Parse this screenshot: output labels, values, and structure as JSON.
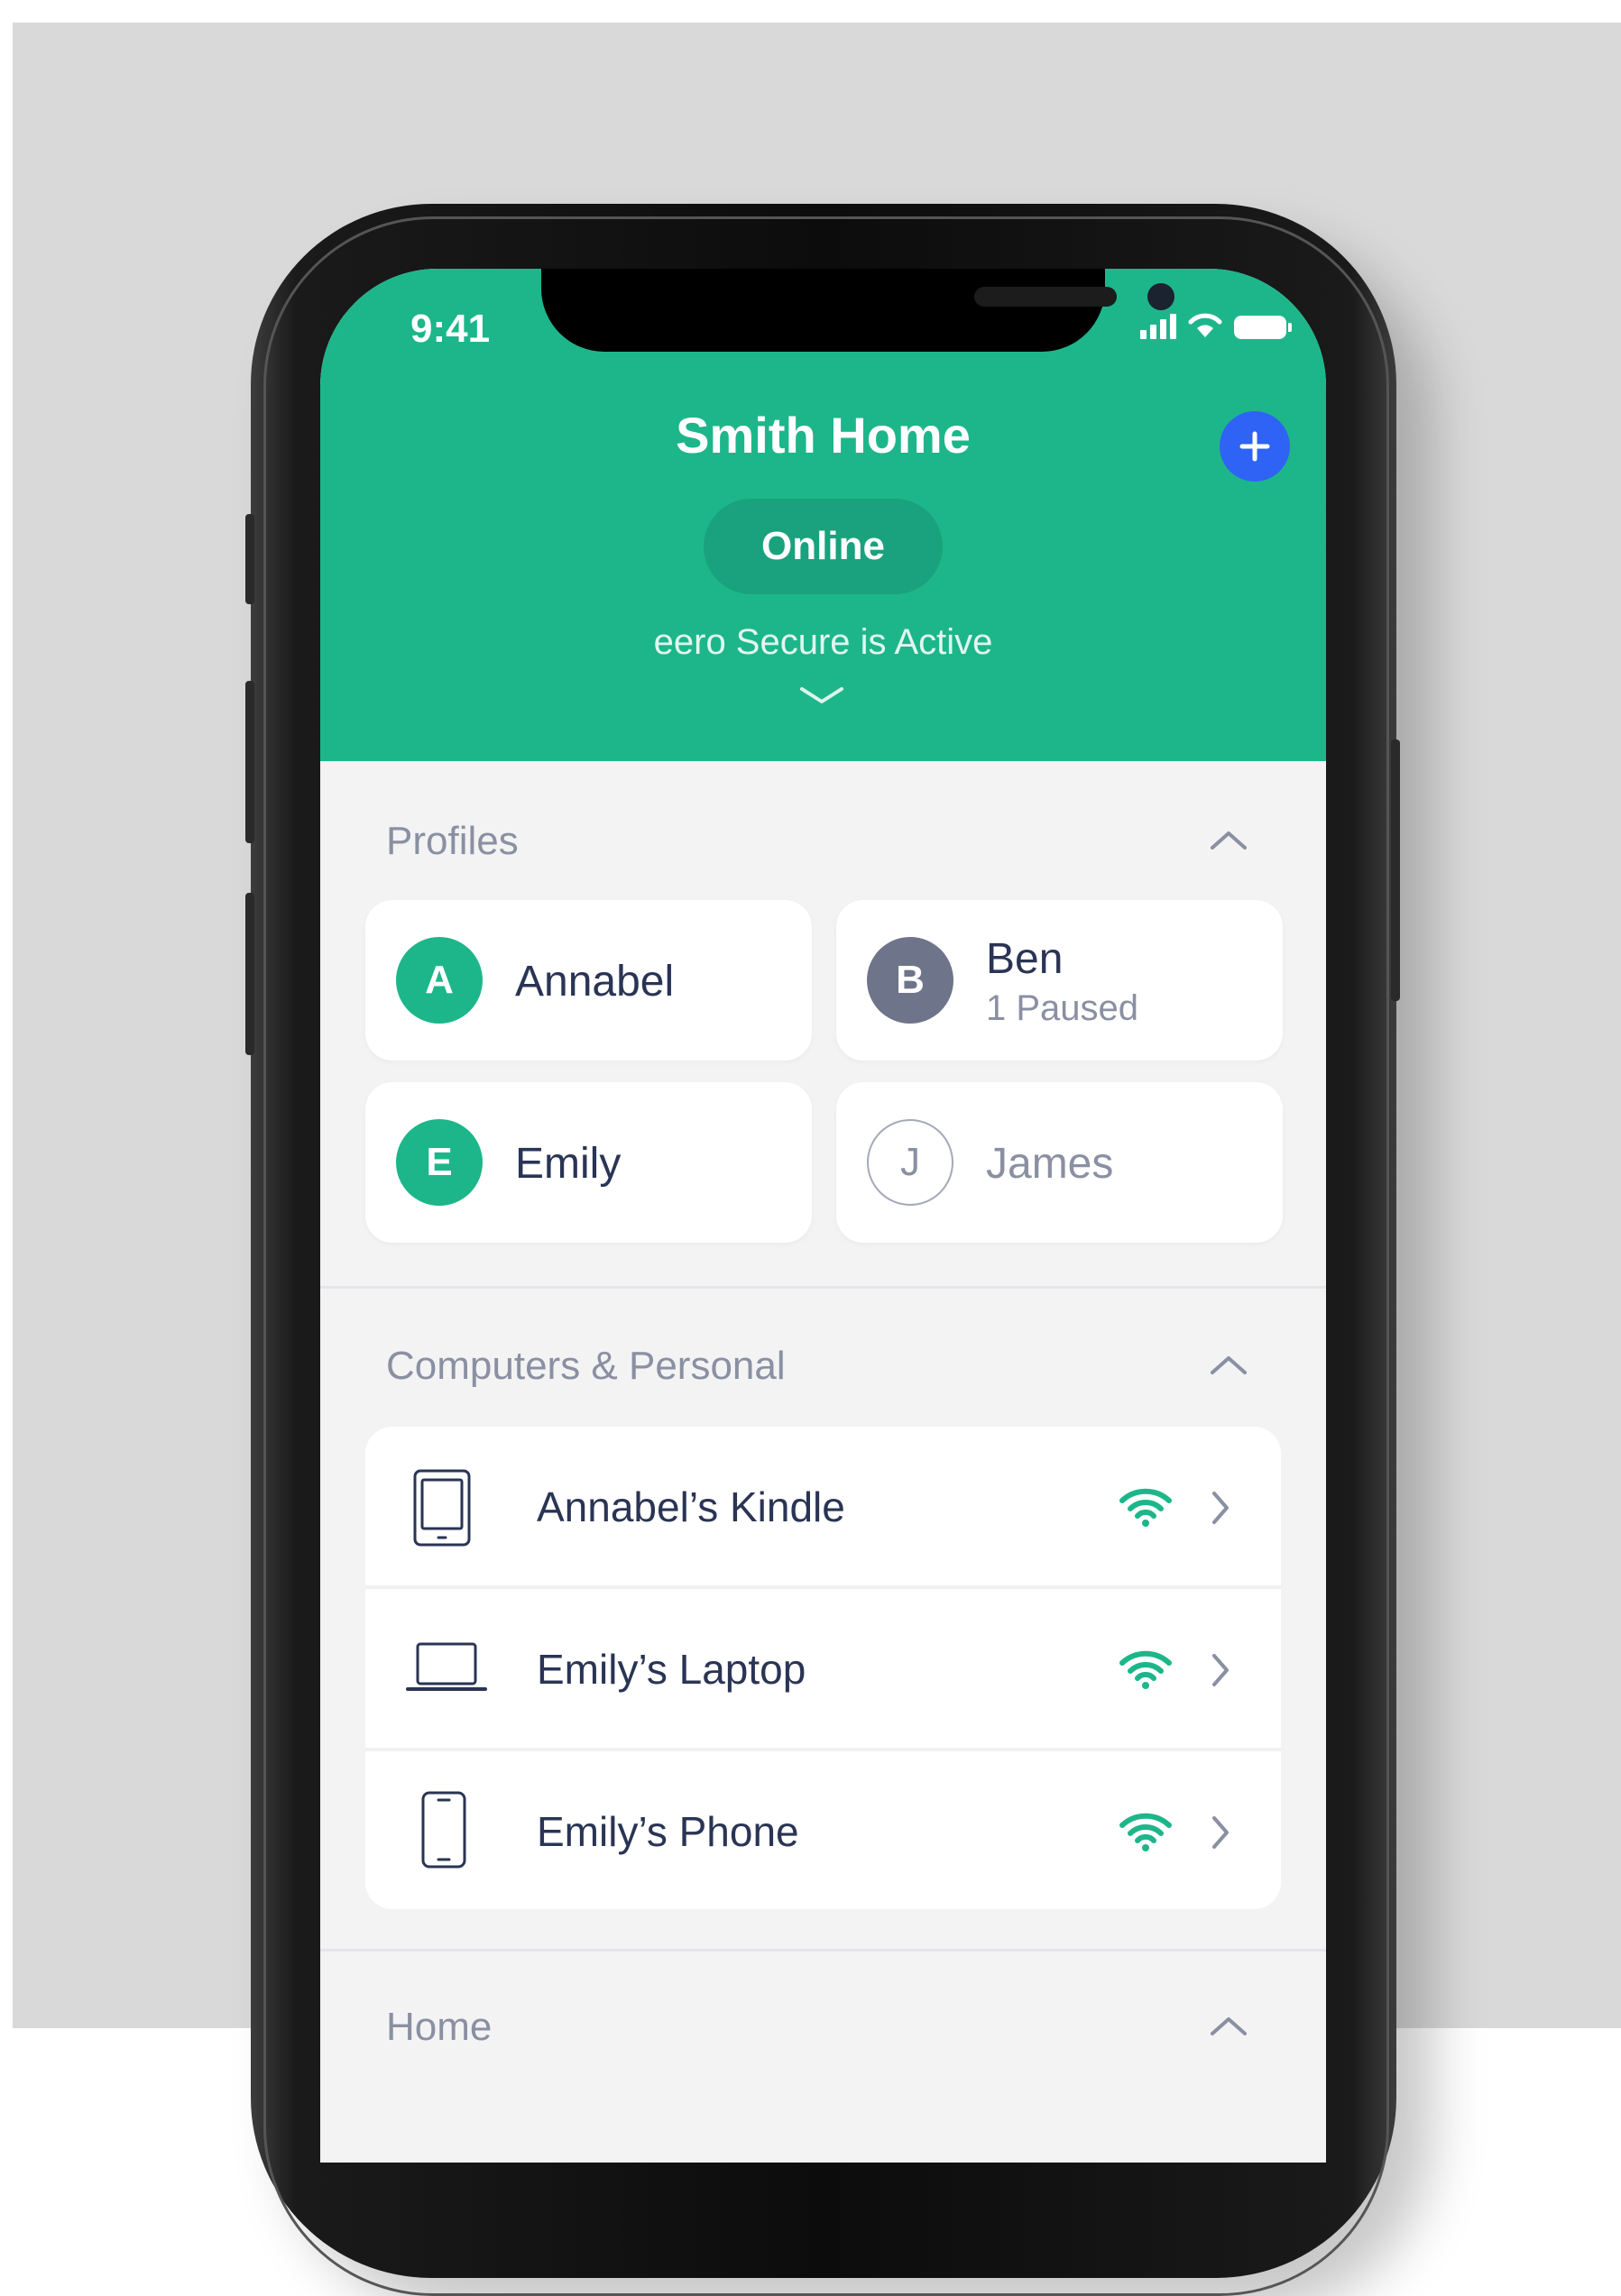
{
  "status_bar": {
    "time": "9:41"
  },
  "header": {
    "title": "Smith Home",
    "status": "Online",
    "subtitle": "eero Secure is Active",
    "add_icon": "plus-icon",
    "expand_icon": "chevron-down-icon"
  },
  "profiles": {
    "title": "Profiles",
    "items": [
      {
        "initial": "A",
        "name": "Annabel",
        "sub": "",
        "color": "#1db68b"
      },
      {
        "initial": "B",
        "name": "Ben",
        "sub": "1 Paused",
        "color": "#6e7489"
      },
      {
        "initial": "E",
        "name": "Emily",
        "sub": "",
        "color": "#1db68b"
      },
      {
        "initial": "J",
        "name": "James",
        "sub": "",
        "color": "#ffffff"
      }
    ]
  },
  "devices": {
    "title": "Computers & Personal",
    "items": [
      {
        "name": "Annabel’s Kindle",
        "icon": "tablet-icon"
      },
      {
        "name": "Emily’s Laptop",
        "icon": "laptop-icon"
      },
      {
        "name": "Emily’s Phone",
        "icon": "phone-icon"
      }
    ]
  },
  "next_section": {
    "title": "Home"
  },
  "colors": {
    "accent": "#1db68b",
    "primary_button": "#2f63f5",
    "text": "#2a3454",
    "muted": "#8a90a2"
  }
}
